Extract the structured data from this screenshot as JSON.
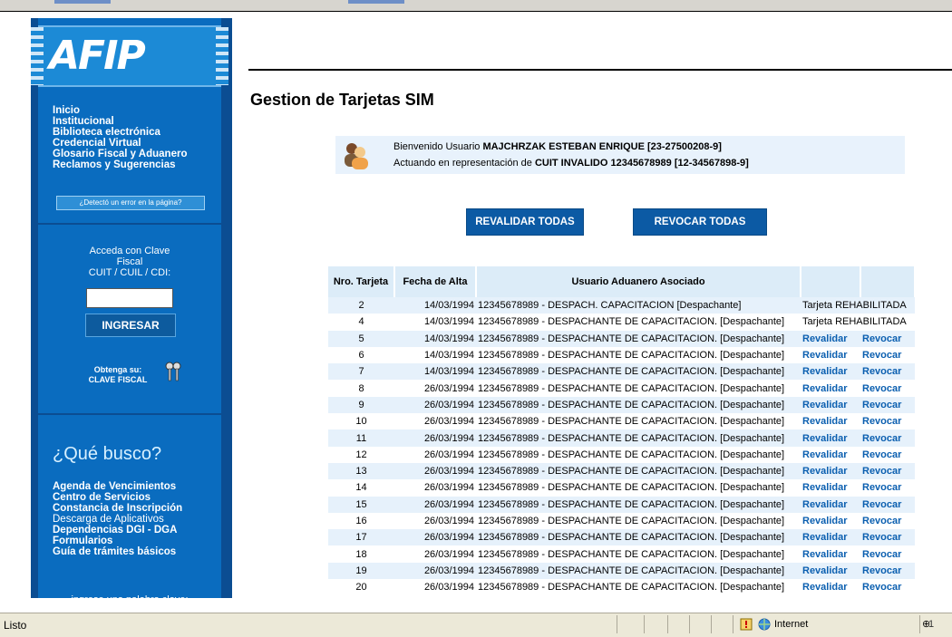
{
  "logo": {
    "text": "AFIP"
  },
  "sidebar": {
    "menu": [
      "Inicio",
      "Institucional",
      "Biblioteca electrónica",
      "Credencial Virtual",
      "Glosario Fiscal y Aduanero",
      "Reclamos y Sugerencias"
    ],
    "error_link": "¿Detectó un error en la página?",
    "login": {
      "title_line1": "Acceda con Clave",
      "title_line2": "Fiscal",
      "field_label": "CUIT / CUIL / CDI:",
      "input_value": "",
      "button": "INGRESAR"
    },
    "obtenga": {
      "line1": "Obtenga su:",
      "line2": "CLAVE FISCAL"
    },
    "que_busco": "¿Qué busco?",
    "links": [
      "Agenda de Vencimientos",
      "Centro de Servicios",
      "Constancia de Inscripción",
      "Descarga de Aplicativos",
      "Dependencias DGI - DGA",
      "Formularios",
      "Guía de trámites básicos"
    ],
    "keyword_label": "ingrese una palabra clave:"
  },
  "main": {
    "title": "Gestion de Tarjetas SIM",
    "welcome": {
      "line1_prefix": "Bienvenido Usuario",
      "user": "MAJCHRZAK ESTEBAN ENRIQUE [23-27500208-9]",
      "line2_prefix": "Actuando en representación de",
      "cuit": "CUIT INVALIDO 12345678989 [12-34567898-9]"
    },
    "buttons": {
      "revalidar_todas": "REVALIDAR TODAS",
      "revocar_todas": "REVOCAR TODAS"
    },
    "table": {
      "headers": [
        "Nro. Tarjeta",
        "Fecha de Alta",
        "Usuario Aduanero Asociado",
        "",
        ""
      ],
      "rows": [
        {
          "nro": "2",
          "fecha": "14/03/1994",
          "usuario": "12345678989 - DESPACH. CAPACITACION [Despachante]",
          "status": "Tarjeta REHABILITADA"
        },
        {
          "nro": "4",
          "fecha": "14/03/1994",
          "usuario": "12345678989 - DESPACHANTE DE CAPACITACION. [Despachante]",
          "status": "Tarjeta REHABILITADA"
        },
        {
          "nro": "5",
          "fecha": "14/03/1994",
          "usuario": "12345678989 - DESPACHANTE DE CAPACITACION. [Despachante]",
          "revalidar": "Revalidar",
          "revocar": "Revocar"
        },
        {
          "nro": "6",
          "fecha": "14/03/1994",
          "usuario": "12345678989 - DESPACHANTE DE CAPACITACION. [Despachante]",
          "revalidar": "Revalidar",
          "revocar": "Revocar"
        },
        {
          "nro": "7",
          "fecha": "14/03/1994",
          "usuario": "12345678989 - DESPACHANTE DE CAPACITACION. [Despachante]",
          "revalidar": "Revalidar",
          "revocar": "Revocar"
        },
        {
          "nro": "8",
          "fecha": "26/03/1994",
          "usuario": "12345678989 - DESPACHANTE DE CAPACITACION. [Despachante]",
          "revalidar": "Revalidar",
          "revocar": "Revocar"
        },
        {
          "nro": "9",
          "fecha": "26/03/1994",
          "usuario": "12345678989 - DESPACHANTE DE CAPACITACION. [Despachante]",
          "revalidar": "Revalidar",
          "revocar": "Revocar"
        },
        {
          "nro": "10",
          "fecha": "26/03/1994",
          "usuario": "12345678989 - DESPACHANTE DE CAPACITACION. [Despachante]",
          "revalidar": "Revalidar",
          "revocar": "Revocar"
        },
        {
          "nro": "11",
          "fecha": "26/03/1994",
          "usuario": "12345678989 - DESPACHANTE DE CAPACITACION. [Despachante]",
          "revalidar": "Revalidar",
          "revocar": "Revocar"
        },
        {
          "nro": "12",
          "fecha": "26/03/1994",
          "usuario": "12345678989 - DESPACHANTE DE CAPACITACION. [Despachante]",
          "revalidar": "Revalidar",
          "revocar": "Revocar"
        },
        {
          "nro": "13",
          "fecha": "26/03/1994",
          "usuario": "12345678989 - DESPACHANTE DE CAPACITACION. [Despachante]",
          "revalidar": "Revalidar",
          "revocar": "Revocar"
        },
        {
          "nro": "14",
          "fecha": "26/03/1994",
          "usuario": "12345678989 - DESPACHANTE DE CAPACITACION. [Despachante]",
          "revalidar": "Revalidar",
          "revocar": "Revocar"
        },
        {
          "nro": "15",
          "fecha": "26/03/1994",
          "usuario": "12345678989 - DESPACHANTE DE CAPACITACION. [Despachante]",
          "revalidar": "Revalidar",
          "revocar": "Revocar"
        },
        {
          "nro": "16",
          "fecha": "26/03/1994",
          "usuario": "12345678989 - DESPACHANTE DE CAPACITACION. [Despachante]",
          "revalidar": "Revalidar",
          "revocar": "Revocar"
        },
        {
          "nro": "17",
          "fecha": "26/03/1994",
          "usuario": "12345678989 - DESPACHANTE DE CAPACITACION. [Despachante]",
          "revalidar": "Revalidar",
          "revocar": "Revocar"
        },
        {
          "nro": "18",
          "fecha": "26/03/1994",
          "usuario": "12345678989 - DESPACHANTE DE CAPACITACION. [Despachante]",
          "revalidar": "Revalidar",
          "revocar": "Revocar"
        },
        {
          "nro": "19",
          "fecha": "26/03/1994",
          "usuario": "12345678989 - DESPACHANTE DE CAPACITACION. [Despachante]",
          "revalidar": "Revalidar",
          "revocar": "Revocar"
        },
        {
          "nro": "20",
          "fecha": "26/03/1994",
          "usuario": "12345678989 - DESPACHANTE DE CAPACITACION. [Despachante]",
          "revalidar": "Revalidar",
          "revocar": "Revocar"
        }
      ]
    }
  },
  "statusbar": {
    "status": "Listo",
    "zone": "Internet",
    "zoom": "1"
  },
  "icons": {
    "avatar": "users-icon",
    "key": "key-icon",
    "zone": "globe-icon",
    "warning": "warning-icon",
    "zoom": "zoom-icon"
  },
  "colors": {
    "sidebar": "#0a6cbf",
    "button": "#0c5aa4",
    "link": "#0b5fb0",
    "row_alt": "#e6f1fb"
  }
}
